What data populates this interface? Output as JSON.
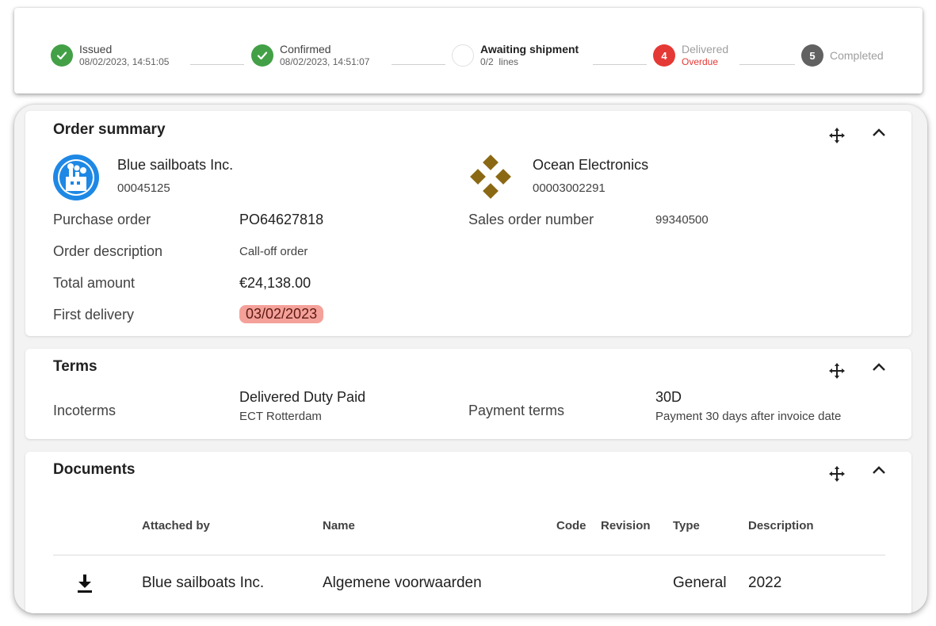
{
  "stepper": {
    "steps": [
      {
        "title": "Issued",
        "sub": "08/02/2023, 14:51:05",
        "state": "done"
      },
      {
        "title": "Confirmed",
        "sub": "08/02/2023, 14:51:07",
        "state": "done"
      },
      {
        "title": "Awaiting shipment",
        "sub_count": "0/2",
        "sub_unit": "lines",
        "state": "current"
      },
      {
        "title": "Delivered",
        "sub": "Overdue",
        "number": "4",
        "state": "error"
      },
      {
        "title": "Completed",
        "number": "5",
        "state": "future"
      }
    ]
  },
  "order_summary": {
    "title": "Order summary",
    "buyer": {
      "name": "Blue sailboats Inc.",
      "id": "00045125"
    },
    "seller": {
      "name": "Ocean Electronics",
      "id": "00003002291"
    },
    "fields": {
      "purchase_order_label": "Purchase order",
      "purchase_order_value": "PO64627818",
      "sales_order_label": "Sales order number",
      "sales_order_value": "99340500",
      "description_label": "Order description",
      "description_value": "Call-off order",
      "total_label": "Total amount",
      "total_value": "€24,138.00",
      "first_delivery_label": "First delivery",
      "first_delivery_value": "03/02/2023"
    }
  },
  "terms": {
    "title": "Terms",
    "incoterms_label": "Incoterms",
    "incoterms_value": "Delivered Duty Paid",
    "incoterms_location": "ECT Rotterdam",
    "payment_label": "Payment terms",
    "payment_value": "30D",
    "payment_desc": "Payment 30 days after invoice date"
  },
  "documents": {
    "title": "Documents",
    "columns": [
      "Attached by",
      "Name",
      "Code",
      "Revision",
      "Type",
      "Description"
    ],
    "rows": [
      {
        "attached_by": "Blue sailboats Inc.",
        "name": "Algemene voorwaarden",
        "code": "",
        "revision": "",
        "type": "General",
        "description": "2022"
      }
    ]
  },
  "colors": {
    "done": "#43a047",
    "error": "#e53935",
    "future": "#616161",
    "overdue_highlight": "#f4a199",
    "buyer_logo": "#1e88e5",
    "seller_logo": "#8b6914"
  }
}
